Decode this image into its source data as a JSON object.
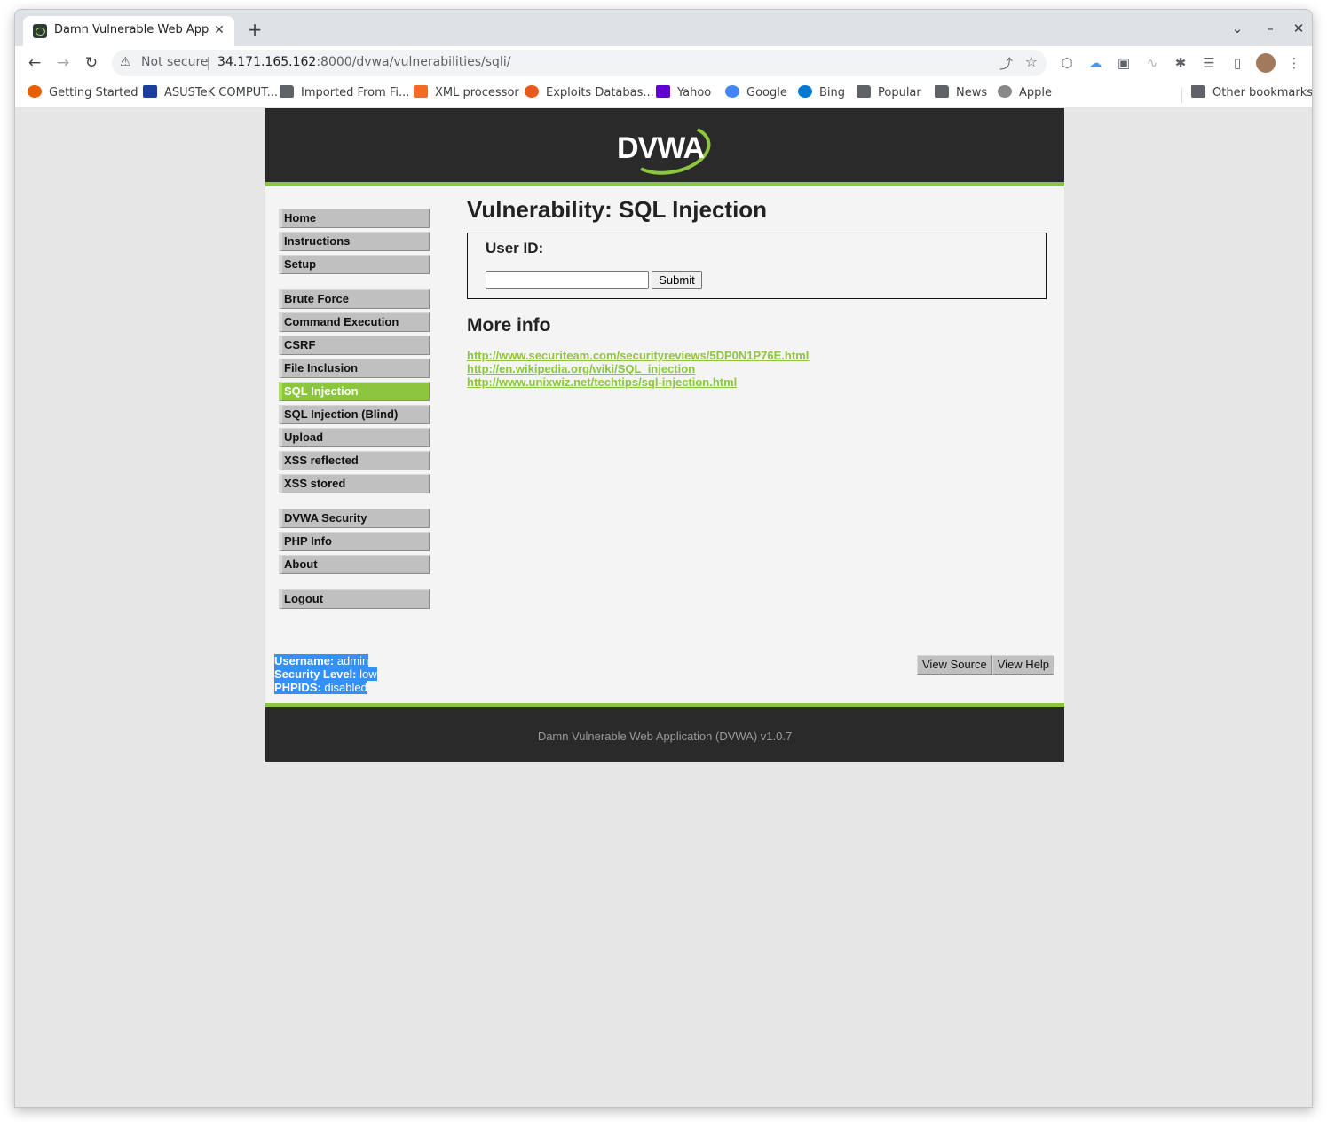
{
  "browser": {
    "tab_title": "Damn Vulnerable Web App (DVWA)",
    "tab_close": "✕",
    "new_tab": "+",
    "window_controls": {
      "chevron": "⌄",
      "minimize": "–",
      "close": "✕"
    },
    "nav": {
      "back": "←",
      "forward": "→",
      "reload": "↻"
    },
    "security_warning_icon": "warning-triangle-icon",
    "security_label": "Not secure",
    "url_host": "34.171.165.162",
    "url_rest": ":8000/dvwa/vulnerabilities/sqli/",
    "bookmarks": [
      {
        "label": "Getting Started",
        "icon": "firefox-icon",
        "color": "#e66000"
      },
      {
        "label": "ASUSTeK COMPUT...",
        "icon": "asus-icon",
        "color": "#1a3e9c"
      },
      {
        "label": "Imported From Fi...",
        "icon": "folder-icon",
        "color": "#5f6368"
      },
      {
        "label": "XML processor",
        "icon": "z-icon",
        "color": "#f26b21"
      },
      {
        "label": "Exploits Databas...",
        "icon": "exploitdb-icon",
        "color": "#e85a1c"
      },
      {
        "label": "Yahoo",
        "icon": "yahoo-icon",
        "color": "#6001d2"
      },
      {
        "label": "Google",
        "icon": "google-icon",
        "color": "#4285f4"
      },
      {
        "label": "Bing",
        "icon": "bing-icon",
        "color": "#0078d4"
      },
      {
        "label": "Popular",
        "icon": "folder-icon",
        "color": "#5f6368"
      },
      {
        "label": "News",
        "icon": "folder-icon",
        "color": "#5f6368"
      },
      {
        "label": "Apple",
        "icon": "apple-icon",
        "color": "#888888"
      }
    ],
    "other_bookmarks": "Other bookmarks"
  },
  "dvwa": {
    "logo_text": "DVWA",
    "menu": {
      "group1": [
        "Home",
        "Instructions",
        "Setup"
      ],
      "group2": [
        "Brute Force",
        "Command Execution",
        "CSRF",
        "File Inclusion",
        "SQL Injection",
        "SQL Injection (Blind)",
        "Upload",
        "XSS reflected",
        "XSS stored"
      ],
      "group3": [
        "DVWA Security",
        "PHP Info",
        "About"
      ],
      "group4": [
        "Logout"
      ],
      "selected": "SQL Injection"
    },
    "page_title": "Vulnerability: SQL Injection",
    "form": {
      "label": "User ID:",
      "input_value": "",
      "submit": "Submit"
    },
    "more_info_heading": "More info",
    "links": [
      "http://www.securiteam.com/securityreviews/5DP0N1P76E.html",
      "http://en.wikipedia.org/wiki/SQL_injection",
      "http://www.unixwiz.net/techtips/sql-injection.html"
    ],
    "status": {
      "username_label": "Username:",
      "username": "admin",
      "security_label": "Security Level:",
      "security": "low",
      "phpids_label": "PHPIDS:",
      "phpids": "disabled"
    },
    "view_source": "View Source",
    "view_help": "View Help",
    "footer": "Damn Vulnerable Web Application (DVWA) v1.0.7"
  },
  "colors": {
    "accent": "#8cc63f",
    "header_bg": "#2a2a2a",
    "menu_bg": "#c0c0c0",
    "selection": "#3390ff"
  }
}
